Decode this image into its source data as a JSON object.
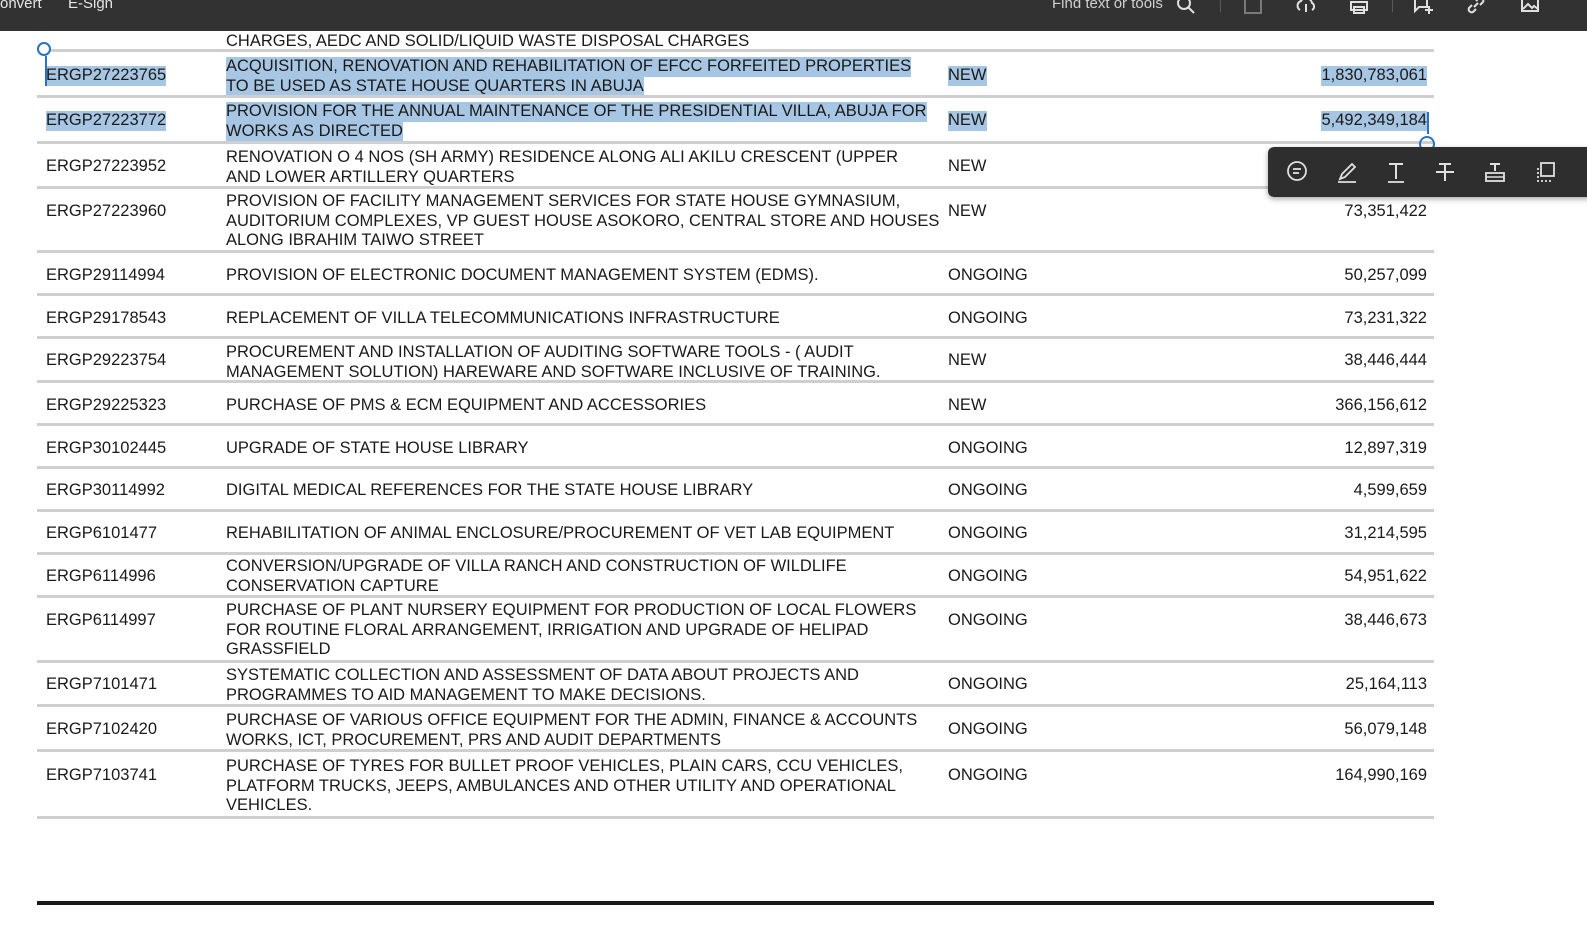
{
  "toolbar": {
    "convert_label": "onvert",
    "esign_label": "E-Sign",
    "find_placeholder": "Find text or tools",
    "icons": [
      "search-icon",
      "save-icon",
      "upload-icon",
      "print-icon",
      "add-comment-icon",
      "link-icon",
      "image-icon"
    ]
  },
  "rows": [
    {
      "code": "",
      "desc": [
        "CHARGES, AEDC AND SOLID/LIQUID WASTE DISPOSAL CHARGES"
      ],
      "status": "",
      "amount": "",
      "selected": false
    },
    {
      "code": "ERGP27223765",
      "desc": [
        "ACQUISITION, RENOVATION AND REHABILITATION OF EFCC FORFEITED PROPERTIES",
        "TO BE USED AS STATE HOUSE QUARTERS IN ABUJA"
      ],
      "status": "NEW",
      "amount": "1,830,783,061",
      "selected": true
    },
    {
      "code": "ERGP27223772",
      "desc": [
        "PROVISION FOR THE ANNUAL MAINTENANCE OF THE PRESIDENTIAL VILLA, ABUJA FOR",
        "WORKS AS DIRECTED"
      ],
      "status": "NEW",
      "amount": "5,492,349,184",
      "selected": true
    },
    {
      "code": "ERGP27223952",
      "desc": [
        "RENOVATION O 4 NOS (SH ARMY) RESIDENCE ALONG ALI AKILU CRESCENT (UPPER",
        "AND LOWER ARTILLERY QUARTERS"
      ],
      "status": "NEW",
      "amount": "",
      "selected": false
    },
    {
      "code": "ERGP27223960",
      "desc": [
        "PROVISION OF FACILITY MANAGEMENT SERVICES FOR STATE HOUSE GYMNASIUM,",
        "AUDITORIUM COMPLEXES, VP GUEST HOUSE ASOKORO, CENTRAL STORE AND HOUSES",
        "ALONG IBRAHIM TAIWO STREET"
      ],
      "status": "NEW",
      "amount": "73,351,422",
      "selected": false
    },
    {
      "code": "ERGP29114994",
      "desc": [
        "PROVISION OF ELECTRONIC DOCUMENT MANAGEMENT SYSTEM (EDMS)."
      ],
      "status": "ONGOING",
      "amount": "50,257,099",
      "selected": false
    },
    {
      "code": "ERGP29178543",
      "desc": [
        "REPLACEMENT OF VILLA TELECOMMUNICATIONS INFRASTRUCTURE"
      ],
      "status": "ONGOING",
      "amount": "73,231,322",
      "selected": false
    },
    {
      "code": "ERGP29223754",
      "desc": [
        "PROCUREMENT AND INSTALLATION OF AUDITING SOFTWARE TOOLS - ( AUDIT",
        "MANAGEMENT SOLUTION) HAREWARE AND SOFTWARE INCLUSIVE OF TRAINING."
      ],
      "status": "NEW",
      "amount": "38,446,444",
      "selected": false
    },
    {
      "code": "ERGP29225323",
      "desc": [
        "PURCHASE OF PMS & ECM EQUIPMENT AND ACCESSORIES"
      ],
      "status": "NEW",
      "amount": "366,156,612",
      "selected": false
    },
    {
      "code": "ERGP30102445",
      "desc": [
        "UPGRADE OF STATE HOUSE LIBRARY"
      ],
      "status": "ONGOING",
      "amount": "12,897,319",
      "selected": false
    },
    {
      "code": "ERGP30114992",
      "desc": [
        "DIGITAL MEDICAL REFERENCES FOR THE STATE HOUSE LIBRARY"
      ],
      "status": "ONGOING",
      "amount": "4,599,659",
      "selected": false
    },
    {
      "code": "ERGP6101477",
      "desc": [
        "REHABILITATION OF ANIMAL ENCLOSURE/PROCUREMENT OF VET LAB EQUIPMENT"
      ],
      "status": "ONGOING",
      "amount": "31,214,595",
      "selected": false
    },
    {
      "code": "ERGP6114996",
      "desc": [
        "CONVERSION/UPGRADE OF VILLA RANCH AND CONSTRUCTION OF WILDLIFE",
        "CONSERVATION CAPTURE"
      ],
      "status": "ONGOING",
      "amount": "54,951,622",
      "selected": false
    },
    {
      "code": "ERGP6114997",
      "desc": [
        "PURCHASE OF PLANT NURSERY EQUIPMENT FOR PRODUCTION OF LOCAL FLOWERS",
        "FOR ROUTINE FLORAL ARRANGEMENT, IRRIGATION AND UPGRADE OF HELIPAD",
        "GRASSFIELD"
      ],
      "status": "ONGOING",
      "amount": "38,446,673",
      "selected": false
    },
    {
      "code": "ERGP7101471",
      "desc": [
        "SYSTEMATIC COLLECTION AND ASSESSMENT OF DATA ABOUT PROJECTS AND",
        "PROGRAMMES TO AID MANAGEMENT TO MAKE DECISIONS."
      ],
      "status": "ONGOING",
      "amount": "25,164,113",
      "selected": false
    },
    {
      "code": "ERGP7102420",
      "desc": [
        "PURCHASE OF VARIOUS OFFICE EQUIPMENT FOR THE ADMIN, FINANCE & ACCOUNTS",
        "WORKS, ICT, PROCUREMENT, PRS AND AUDIT DEPARTMENTS"
      ],
      "status": "ONGOING",
      "amount": "56,079,148",
      "selected": false
    },
    {
      "code": "ERGP7103741",
      "desc": [
        "PURCHASE OF TYRES FOR BULLET PROOF VEHICLES, PLAIN CARS, CCU VEHICLES,",
        "PLATFORM TRUCKS, JEEPS, AMBULANCES AND OTHER UTILITY AND OPERATIONAL",
        "VEHICLES."
      ],
      "status": "ONGOING",
      "amount": "164,990,169",
      "selected": false
    }
  ],
  "annotate_toolbar": {
    "icons": [
      "comment-icon",
      "highlight-pen-icon",
      "text-insert-icon",
      "strikethrough-icon",
      "replace-text-icon",
      "copy-icon"
    ]
  },
  "colors": {
    "toolbar_bg": "#323232",
    "selection": "#a7c6e3",
    "handle": "#2a72c4"
  }
}
